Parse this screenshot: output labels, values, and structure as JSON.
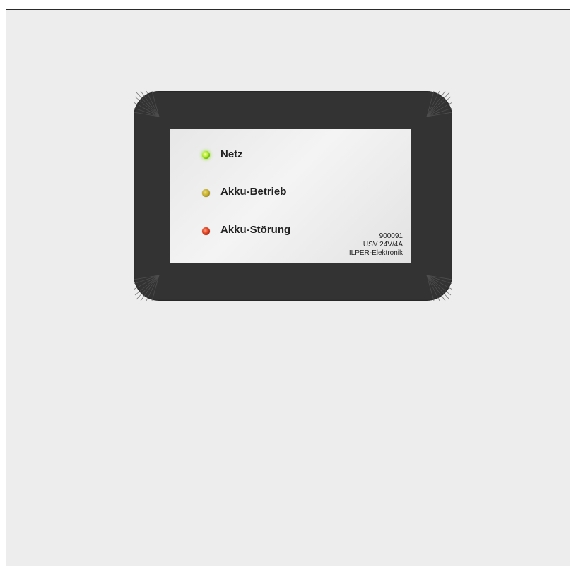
{
  "panel": {
    "indicators": [
      {
        "label": "Netz",
        "color": "#9be01a",
        "state": "on"
      },
      {
        "label": "Akku-Betrieb",
        "color": "#c9b02a",
        "state": "off"
      },
      {
        "label": "Akku-Störung",
        "color": "#e0401e",
        "state": "off"
      }
    ],
    "product_code": "900091",
    "model": "USV 24V/4A",
    "manufacturer": "ILPER-Elektronik"
  }
}
